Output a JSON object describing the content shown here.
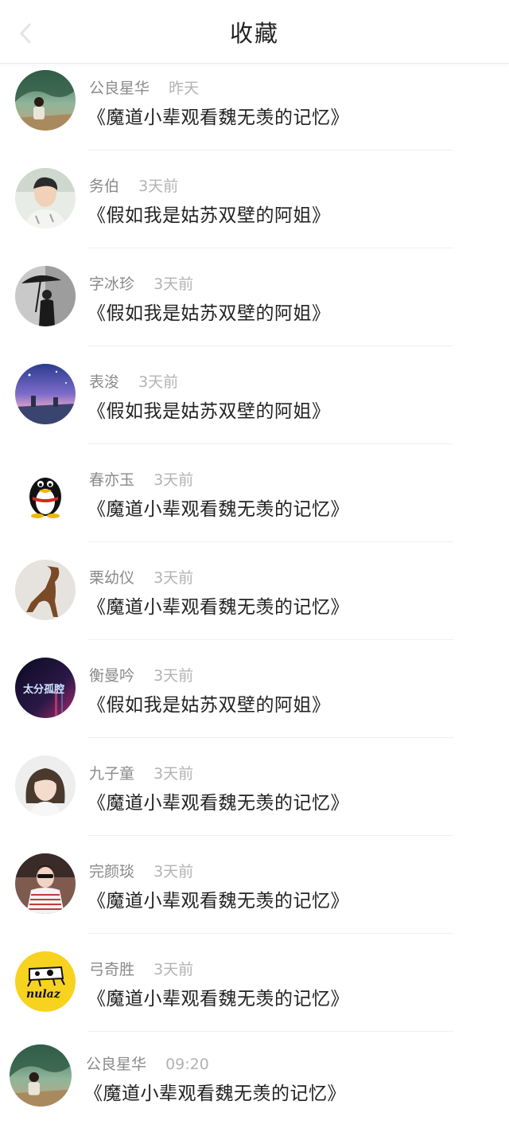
{
  "header": {
    "title": "收藏"
  },
  "items": [
    {
      "name": "公良星华",
      "time": "昨天",
      "post": "《魔道小辈观看魏无羡的记忆》"
    },
    {
      "name": "务伯",
      "time": "3天前",
      "post": "《假如我是姑苏双壁的阿姐》"
    },
    {
      "name": "字冰珍",
      "time": "3天前",
      "post": "《假如我是姑苏双壁的阿姐》"
    },
    {
      "name": "表浚",
      "time": "3天前",
      "post": "《假如我是姑苏双壁的阿姐》"
    },
    {
      "name": "春亦玉",
      "time": "3天前",
      "post": "《魔道小辈观看魏无羡的记忆》"
    },
    {
      "name": "栗幼仪",
      "time": "3天前",
      "post": "《魔道小辈观看魏无羡的记忆》"
    },
    {
      "name": "衡曼吟",
      "time": "3天前",
      "post": "《假如我是姑苏双壁的阿姐》"
    },
    {
      "name": "九子童",
      "time": "3天前",
      "post": "《魔道小辈观看魏无羡的记忆》"
    },
    {
      "name": "完颜琰",
      "time": "3天前",
      "post": "《魔道小辈观看魏无羡的记忆》"
    },
    {
      "name": "弓奇胜",
      "time": "3天前",
      "post": "《魔道小辈观看魏无羡的记忆》"
    },
    {
      "name": "公良星华",
      "time": "09:20",
      "post": "《魔道小辈观看魏无羡的记忆》"
    }
  ],
  "avatar_text": {
    "item7": "太分孤腔",
    "item10": "nulaz"
  }
}
